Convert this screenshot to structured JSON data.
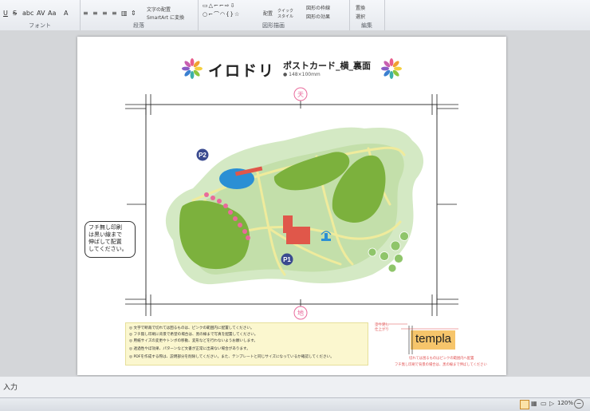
{
  "ribbon": {
    "groups": [
      {
        "label": "フォント"
      },
      {
        "label": "段落"
      },
      {
        "label": "図形描画"
      },
      {
        "label": "編集"
      }
    ],
    "paragraph": {
      "text_direction": "文字の配置",
      "smartart": "SmartArt に変換"
    },
    "drawing": {
      "arrange": "配置",
      "quick_styles": "クイック\nスタイル",
      "shape_outline": "図形の枠線",
      "shape_effects": "図形の効果"
    },
    "editing": {
      "replace": "置換",
      "select": "選択"
    }
  },
  "page": {
    "brand": "イロドリ",
    "title": "ポストカード_横_裏面",
    "size": "148×100mm",
    "top_mark": "天",
    "bottom_mark": "地",
    "callout": "フチ無し印刷\nは黒い線まで\n伸ばして配置\nしてください。",
    "map_labels": {
      "p1": "P1",
      "p2": "P2"
    },
    "notes": [
      "文字で断裁で切れては困るものは、ピンクの範囲内に配置してください。",
      "フチ無し印刷に背景で希望の場合は、黒の線まで写真を配置してください。",
      "用紙サイズの変更やトンボの移動、変形などを行わないようお願いします。",
      "透過性やぼ効果、パターンなど文書が正常に出来ない場合があります。",
      "PDFを作成する際は、説明部分を削除してください。また、テンプレートと同じサイズになっているか確認してください。"
    ],
    "legend_small": [
      "塗り足し",
      "仕上がり"
    ],
    "template_label": "templa",
    "legend_notes": [
      "切れては困るものはピンクの範囲内へ配置",
      "フチ無し印刷で背景の場合は、黒の線まで伸ばしてください"
    ]
  },
  "input_line": "入力",
  "status": {
    "zoom": "120%"
  },
  "colors": {
    "map_outer": "#d4e9c4",
    "map_inner": "#c3dfaa",
    "field": "#7cb13d",
    "path": "#efeb9c",
    "pond": "#2b8fd4",
    "building": "#e0574a",
    "marker": "#3a4a8f",
    "tree": "#8fc56a",
    "callout_border": "#333333"
  }
}
